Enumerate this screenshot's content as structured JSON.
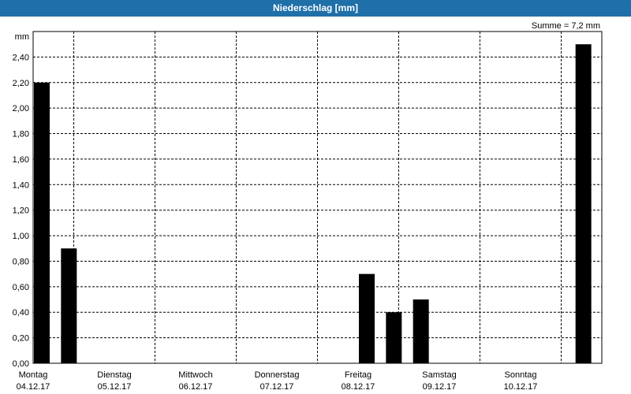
{
  "window": {
    "title": "Niederschlag [mm]"
  },
  "summary": "Summe = 7,2 mm",
  "chart_data": {
    "type": "bar",
    "title": "Niederschlag [mm]",
    "ylabel": "mm",
    "xlabel": "",
    "ylim": [
      0,
      2.6
    ],
    "y_ticks": [
      "0,00",
      "0,20",
      "0,40",
      "0,60",
      "0,80",
      "1,00",
      "1,20",
      "1,40",
      "1,60",
      "1,80",
      "2,00",
      "2,20",
      "2,40"
    ],
    "x_range": [
      0,
      7
    ],
    "x_ticks": [
      {
        "day": "Montag",
        "date": "04.12.17"
      },
      {
        "day": "Dienstag",
        "date": "05.12.17"
      },
      {
        "day": "Mittwoch",
        "date": "06.12.17"
      },
      {
        "day": "Donnerstag",
        "date": "07.12.17"
      },
      {
        "day": "Freitag",
        "date": "08.12.17"
      },
      {
        "day": "Samstag",
        "date": "09.12.17"
      },
      {
        "day": "Sonntag",
        "date": "10.12.17"
      }
    ],
    "bars": [
      {
        "time": "04.12.17 00:00",
        "value": 2.2
      },
      {
        "time": "04.12.17 08:00",
        "value": 0.9
      },
      {
        "time": "08.12.17 00:00",
        "value": 0.7
      },
      {
        "time": "08.12.17 08:00",
        "value": 0.4
      },
      {
        "time": "08.12.17 16:00",
        "value": 0.5
      },
      {
        "time": "10.12.17 16:00",
        "value": 2.5
      }
    ],
    "bar_color": "#000000",
    "grid": true,
    "grid_style": "dashed",
    "total": "7,2 mm"
  }
}
